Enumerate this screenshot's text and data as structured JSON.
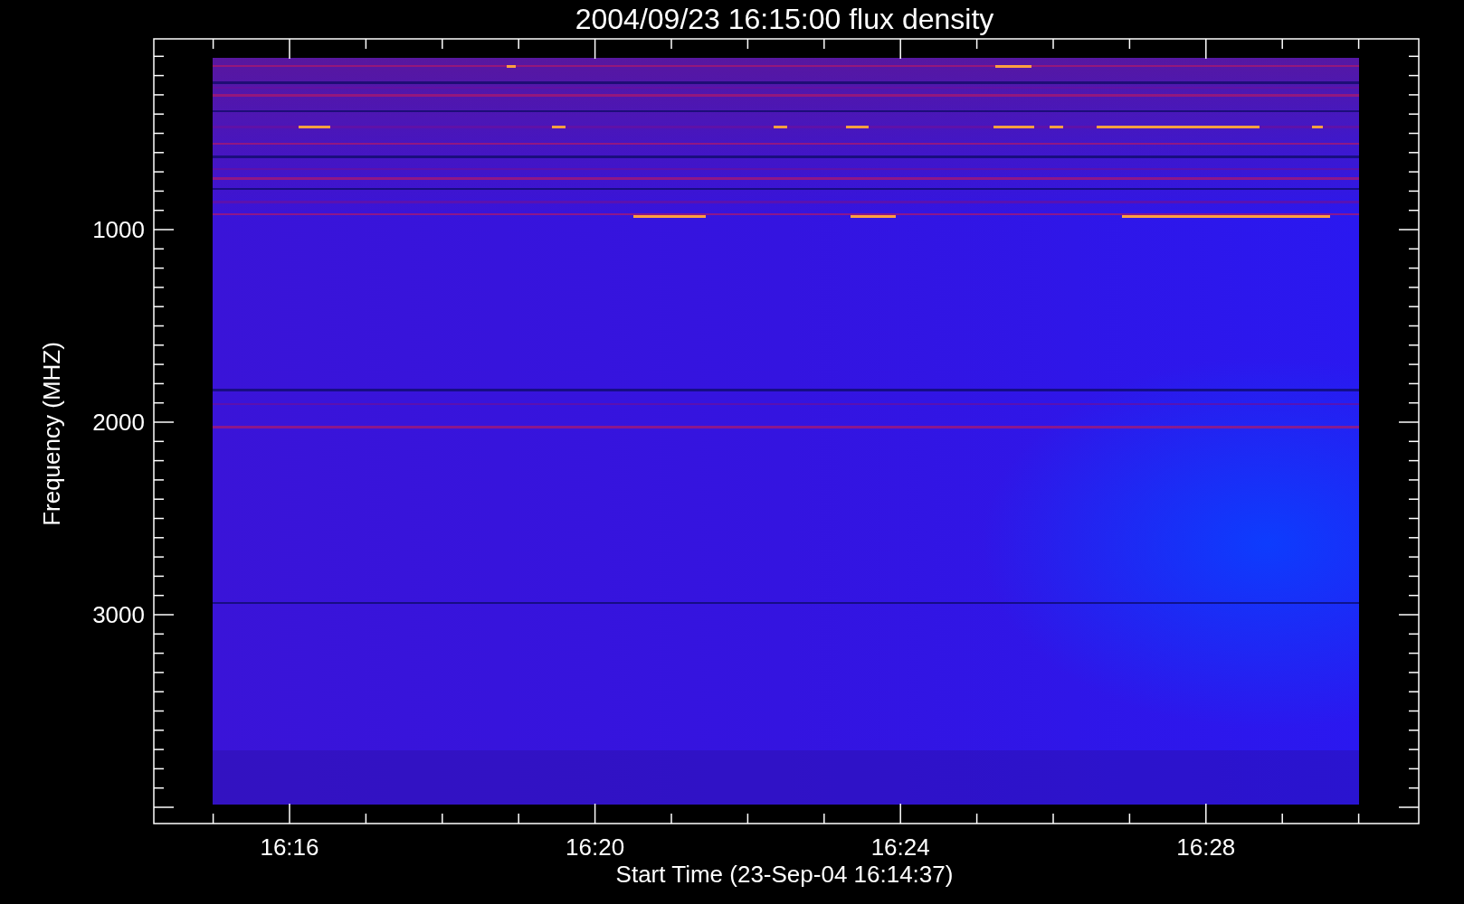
{
  "title": "2004/09/23 16:15:00 flux density",
  "ylabel": "Frequency (MHZ)",
  "yticks": [
    "1000",
    "2000",
    "3000"
  ],
  "xticks": [
    "16:16",
    "16:20",
    "16:24",
    "16:28"
  ],
  "xlabel": "Start Time (23-Sep-04 16:14:37)"
}
